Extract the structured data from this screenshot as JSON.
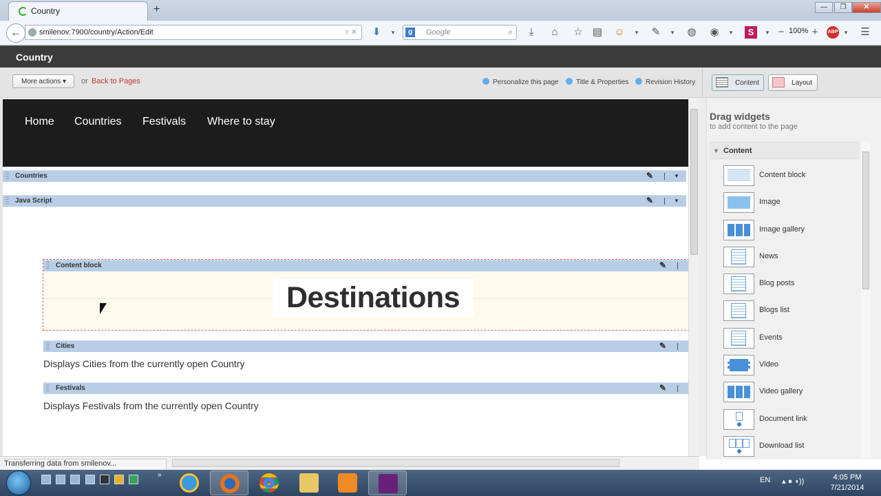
{
  "browser": {
    "tab_title": "Country",
    "new_tab": "+",
    "url": "smilenov:7900/country/Action/Edit",
    "search_placeholder": "Google",
    "search_engine_letter": "g",
    "zoom": "100%",
    "window_controls": {
      "minimize": "—",
      "maximize": "❐",
      "close": "✕"
    }
  },
  "app": {
    "title": "Country"
  },
  "toolbar": {
    "more_actions": "More actions ▾",
    "or": "or",
    "back_to_pages": "Back to Pages",
    "personalize": "Personalize this page",
    "title_properties": "Title & Properties",
    "revision_history": "Revision History",
    "mode_content": "Content",
    "mode_layout": "Layout"
  },
  "site_nav": [
    "Home",
    "Countries",
    "Festivals",
    "Where to stay"
  ],
  "widgets": {
    "countries": "Countries",
    "javascript": "Java Script",
    "content_block": "Content block",
    "cities": "Cities",
    "festivals": "Festivals"
  },
  "content": {
    "destinations_heading": "Destinations",
    "cities_desc": "Displays Cities from the currently open Country",
    "festivals_desc": "Displays Festivals from the currently open Country"
  },
  "side_panel": {
    "title": "Drag widgets",
    "subtitle": "to add content to the page",
    "category": "Content",
    "items": [
      {
        "label": "Content block",
        "icon": "content-block-icon"
      },
      {
        "label": "Image",
        "icon": "image-icon"
      },
      {
        "label": "Image gallery",
        "icon": "image-gallery-icon"
      },
      {
        "label": "News",
        "icon": "news-icon"
      },
      {
        "label": "Blog posts",
        "icon": "blog-posts-icon"
      },
      {
        "label": "Blogs list",
        "icon": "blogs-list-icon"
      },
      {
        "label": "Events",
        "icon": "events-icon"
      },
      {
        "label": "Video",
        "icon": "video-icon"
      },
      {
        "label": "Video gallery",
        "icon": "video-gallery-icon"
      },
      {
        "label": "Document link",
        "icon": "document-link-icon"
      },
      {
        "label": "Download list",
        "icon": "download-list-icon"
      }
    ]
  },
  "status": {
    "text": "Transferring data from smilenov..."
  },
  "taskbar": {
    "language": "EN",
    "time": "4:05 PM",
    "date": "7/21/2014"
  },
  "colors": {
    "app_header": "#3b3b3b",
    "site_nav_bg": "#1c1c1c",
    "widget_bar": "#b8cde6",
    "back_link": "#c0392b",
    "content_block_bg": "#fefaec"
  }
}
